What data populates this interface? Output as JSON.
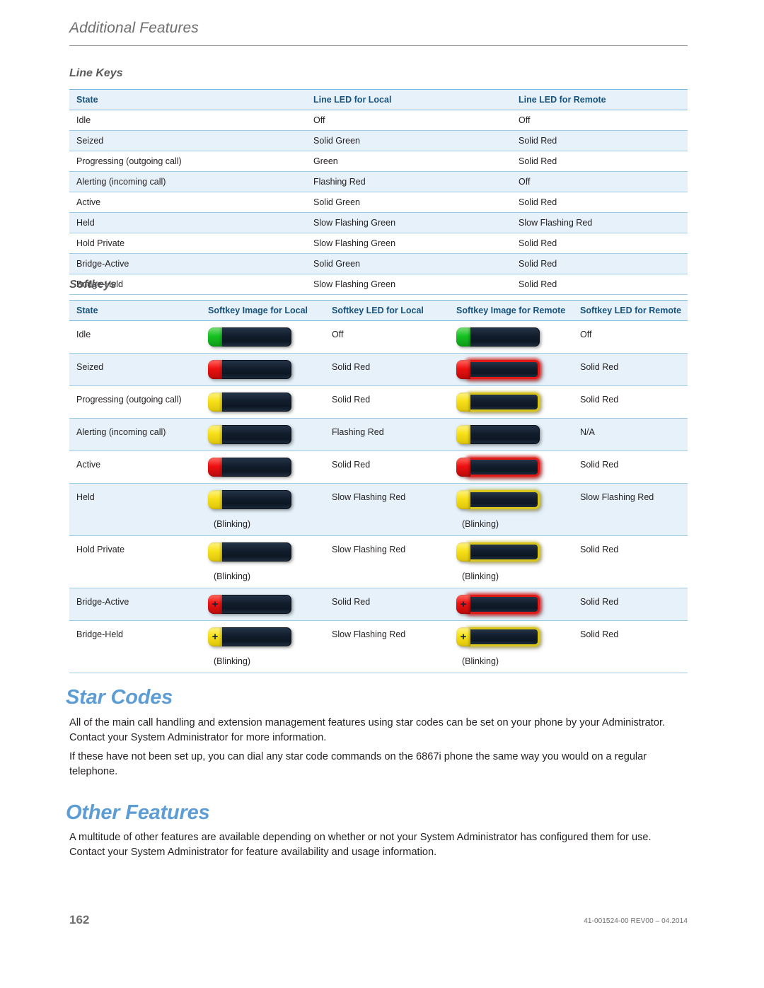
{
  "running_header": {
    "title": "Additional Features"
  },
  "line_keys": {
    "heading": "Line Keys",
    "columns": [
      "State",
      "Line LED for Local",
      "Line LED for Remote"
    ],
    "rows": [
      {
        "state": "Idle",
        "local": "Off",
        "local_color": "plain",
        "remote": "Off",
        "remote_color": "plain"
      },
      {
        "state": "Seized",
        "local": "Solid Green",
        "local_color": "green",
        "remote": "Solid Red",
        "remote_color": "red"
      },
      {
        "state": "Progressing (outgoing call)",
        "local": "Green",
        "local_color": "green",
        "remote": "Solid Red",
        "remote_color": "red"
      },
      {
        "state": "Alerting (incoming call)",
        "local": "Flashing Red",
        "local_color": "red",
        "remote": "Off",
        "remote_color": "plain"
      },
      {
        "state": "Active",
        "local": "Solid Green",
        "local_color": "green",
        "remote": "Solid Red",
        "remote_color": "red"
      },
      {
        "state": "Held",
        "local": "Slow Flashing Green",
        "local_color": "green",
        "remote": "Slow Flashing Red",
        "remote_color": "red"
      },
      {
        "state": "Hold Private",
        "local": "Slow Flashing Green",
        "local_color": "green",
        "remote": "Solid Red",
        "remote_color": "red"
      },
      {
        "state": "Bridge-Active",
        "local": "Solid Green",
        "local_color": "green",
        "remote": "Solid Red",
        "remote_color": "red"
      },
      {
        "state": "Bridge-Held",
        "local": "Slow Flashing Green",
        "local_color": "green",
        "remote": "Solid Red",
        "remote_color": "red"
      }
    ]
  },
  "softkeys": {
    "heading": "Softkeys",
    "columns": [
      "State",
      "Softkey Image for Local",
      "Softkey LED for Local",
      "Softkey Image for Remote",
      "Softkey LED for Remote"
    ],
    "blinking_label": "(Blinking)",
    "rows": [
      {
        "state": "Idle",
        "local_image": {
          "led": "green",
          "frame": "none",
          "plus": ""
        },
        "local_led": "Off",
        "local_led_color": "plain",
        "remote_image": {
          "led": "green",
          "frame": "none",
          "plus": ""
        },
        "remote_led": "Off",
        "remote_led_color": "plain",
        "local_blinking": false,
        "remote_blinking": false
      },
      {
        "state": "Seized",
        "local_image": {
          "led": "red",
          "frame": "none",
          "plus": ""
        },
        "local_led": "Solid Red",
        "local_led_color": "red",
        "remote_image": {
          "led": "red",
          "frame": "red",
          "plus": ""
        },
        "remote_led": "Solid Red",
        "remote_led_color": "red",
        "local_blinking": false,
        "remote_blinking": false
      },
      {
        "state": "Progressing (outgoing call)",
        "local_image": {
          "led": "yellow",
          "frame": "none",
          "plus": ""
        },
        "local_led": "Solid Red",
        "local_led_color": "red",
        "remote_image": {
          "led": "yellow",
          "frame": "yellow",
          "plus": ""
        },
        "remote_led": "Solid Red",
        "remote_led_color": "red",
        "local_blinking": false,
        "remote_blinking": false
      },
      {
        "state": "Alerting (incoming call)",
        "local_image": {
          "led": "yellow",
          "frame": "none",
          "plus": ""
        },
        "local_led": "Flashing Red",
        "local_led_color": "red",
        "remote_image": {
          "led": "yellow",
          "frame": "none",
          "plus": ""
        },
        "remote_led": "N/A",
        "remote_led_color": "plain",
        "local_blinking": false,
        "remote_blinking": false
      },
      {
        "state": "Active",
        "local_image": {
          "led": "red",
          "frame": "none",
          "plus": ""
        },
        "local_led": "Solid Red",
        "local_led_color": "red",
        "remote_image": {
          "led": "red",
          "frame": "red",
          "plus": ""
        },
        "remote_led": "Solid Red",
        "remote_led_color": "red",
        "local_blinking": false,
        "remote_blinking": false
      },
      {
        "state": "Held",
        "local_image": {
          "led": "yellow",
          "frame": "none",
          "plus": ""
        },
        "local_led": "Slow Flashing Red",
        "local_led_color": "red",
        "remote_image": {
          "led": "yellow",
          "frame": "yellow",
          "plus": ""
        },
        "remote_led": "Slow Flashing Red",
        "remote_led_color": "red",
        "local_blinking": true,
        "remote_blinking": true
      },
      {
        "state": "Hold Private",
        "local_image": {
          "led": "yellow",
          "frame": "none",
          "plus": ""
        },
        "local_led": "Slow Flashing Red",
        "local_led_color": "red",
        "remote_image": {
          "led": "yellow",
          "frame": "yellow",
          "plus": ""
        },
        "remote_led": "Solid Red",
        "remote_led_color": "red",
        "local_blinking": true,
        "remote_blinking": true
      },
      {
        "state": "Bridge-Active",
        "local_image": {
          "led": "red",
          "frame": "none",
          "plus": "+"
        },
        "local_led": "Solid Red",
        "local_led_color": "red",
        "remote_image": {
          "led": "red",
          "frame": "red",
          "plus": "+"
        },
        "remote_led": "Solid Red",
        "remote_led_color": "red",
        "local_blinking": false,
        "remote_blinking": false
      },
      {
        "state": "Bridge-Held",
        "local_image": {
          "led": "yellow",
          "frame": "none",
          "plus": "+"
        },
        "local_led": "Slow Flashing Red",
        "local_led_color": "red",
        "remote_image": {
          "led": "yellow",
          "frame": "yellow",
          "plus": "+"
        },
        "remote_led": "Solid Red",
        "remote_led_color": "red",
        "local_blinking": true,
        "remote_blinking": true
      }
    ]
  },
  "star_codes": {
    "heading": "Star Codes",
    "paragraph1": "All of the main call handling and extension management features using star codes can be set on your phone by your Administrator. Contact your System Administrator for more information.",
    "paragraph2": "If these have not been set up, you can dial any star code commands on the 6867i phone the same way you would on a regular telephone."
  },
  "other_features": {
    "heading": "Other Features",
    "paragraph1": "A multitude of other features are available depending on whether or not your System Administrator has configured them for use. Contact your System Administrator for feature availability and usage information."
  },
  "footer": {
    "page_number": "162",
    "document_id": "41-001524-00 REV00 – 04.2014"
  },
  "colors": {
    "heading_blue": "#5d9dd5",
    "table_header_text": "#17527d",
    "table_header_bg": "#e6f1fa",
    "row_stripe": "#e6f1fa",
    "border": "#9ecbe6",
    "green": "#1aa33c",
    "red": "#ee1c25"
  }
}
